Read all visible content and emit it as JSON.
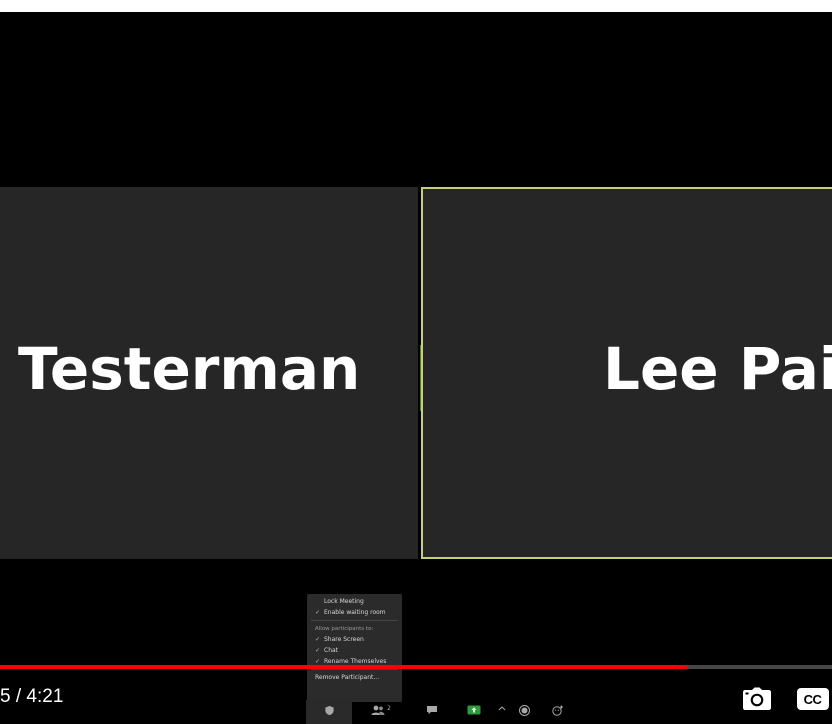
{
  "meeting": {
    "participant_left": "Testerman",
    "participant_right": "Lee Pair",
    "active_speaker_border_color": "#c9cd7d"
  },
  "security_menu": {
    "items": [
      {
        "label": "Lock Meeting",
        "checked": false
      },
      {
        "label": "Enable waiting room",
        "checked": true
      }
    ],
    "allow_header": "Allow participants to:",
    "allow_items": [
      {
        "label": "Share Screen",
        "checked": true
      },
      {
        "label": "Chat",
        "checked": true
      },
      {
        "label": "Rename Themselves",
        "checked": true
      }
    ],
    "remove_label": "Remove Participant..."
  },
  "zoom_toolbar": {
    "participants_count": "2",
    "icons": [
      "security-icon",
      "participants-icon",
      "chat-icon",
      "share-screen-icon",
      "record-icon",
      "reactions-icon"
    ]
  },
  "player": {
    "time_display": "5 / 4:21",
    "progress_fraction": 0.826,
    "progress_color": "#ff0000",
    "cc_label": "CC"
  }
}
